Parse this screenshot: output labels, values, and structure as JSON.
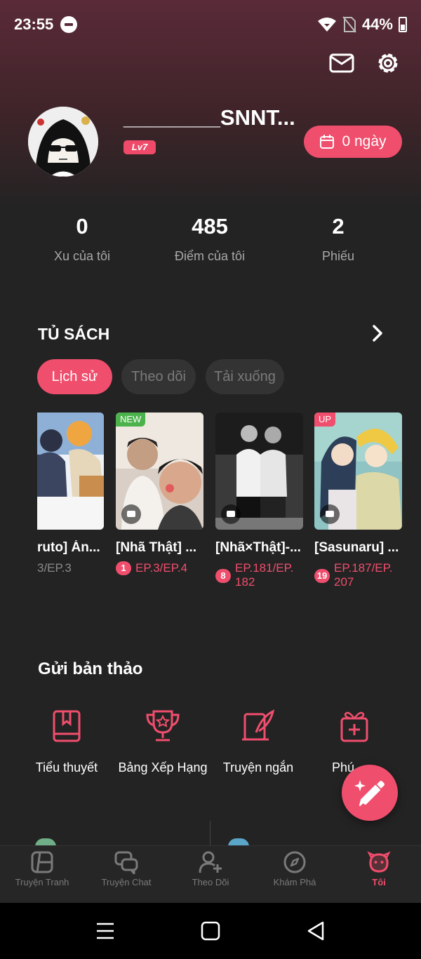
{
  "status_bar": {
    "time": "23:55",
    "battery": "44%"
  },
  "profile": {
    "username": "________SNNT...",
    "level": "Lv7",
    "checkin_label": "0 ngày"
  },
  "stats": [
    {
      "value": "0",
      "label": "Xu của tôi"
    },
    {
      "value": "485",
      "label": "Điểm của tôi"
    },
    {
      "value": "2",
      "label": "Phiếu"
    }
  ],
  "bookshelf": {
    "title": "TỦ SÁCH",
    "tabs": [
      "Lịch sử",
      "Theo dõi",
      "Tải xuống"
    ],
    "active_tab": "Lịch sử",
    "books": [
      {
        "title": "ruto] Án...",
        "ep": "3/EP.3",
        "badge": "",
        "tag": ""
      },
      {
        "title": "[Nhã Thật] ...",
        "ep": "EP.3/EP.4",
        "badge": "1",
        "tag": "NEW"
      },
      {
        "title": "[Nhã×Thật]-...",
        "ep": "EP.181/EP. 182",
        "badge": "8",
        "tag": ""
      },
      {
        "title": "[Sasunaru] ...",
        "ep": "EP.187/EP. 207",
        "badge": "19",
        "tag": "UP"
      }
    ]
  },
  "submission": {
    "title": "Gửi bản thảo",
    "items": [
      {
        "label": "Tiểu thuyết",
        "icon": "book-icon"
      },
      {
        "label": "Bảng Xếp Hạng",
        "icon": "trophy-icon"
      },
      {
        "label": "Truyện ngắn",
        "icon": "quill-icon"
      },
      {
        "label": "Phú",
        "icon": "gift-icon"
      }
    ]
  },
  "bottom_nav": [
    {
      "label": "Truyện Tranh",
      "icon": "comic-icon"
    },
    {
      "label": "Truyện Chat",
      "icon": "chat-icon"
    },
    {
      "label": "Theo Dõi",
      "icon": "follow-icon"
    },
    {
      "label": "Khám Phá",
      "icon": "compass-icon"
    },
    {
      "label": "Tôi",
      "icon": "face-icon"
    }
  ],
  "colors": {
    "accent": "#f04e6d",
    "background": "#232323",
    "header_top": "#5a2a38"
  }
}
